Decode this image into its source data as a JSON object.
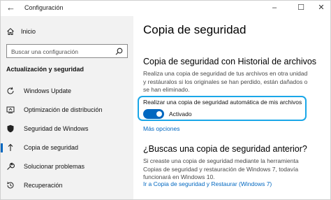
{
  "window": {
    "title": "Configuración"
  },
  "sidebar": {
    "home_label": "Inicio",
    "search_placeholder": "Buscar una configuración",
    "section_title": "Actualización y seguridad",
    "items": [
      {
        "label": "Windows Update",
        "icon": "refresh-icon"
      },
      {
        "label": "Optimización de distribución",
        "icon": "delivery-optimization-icon"
      },
      {
        "label": "Seguridad de Windows",
        "icon": "shield-icon"
      },
      {
        "label": "Copia de seguridad",
        "icon": "backup-arrow-icon",
        "active": true
      },
      {
        "label": "Solucionar problemas",
        "icon": "wrench-icon"
      },
      {
        "label": "Recuperación",
        "icon": "recovery-icon"
      }
    ]
  },
  "main": {
    "title": "Copia de seguridad",
    "history": {
      "heading": "Copia de seguridad con Historial de archivos",
      "description": "Realiza una copia de seguridad de tus archivos en otra unidad y restáuralos si los originales se han perdido, están dañados o se han eliminado.",
      "toggle_label": "Realizar una copia de seguridad automática de mis archivos",
      "toggle_state": "Activado",
      "toggle_on": true,
      "more_options": "Más opciones"
    },
    "older": {
      "heading": "¿Buscas una copia de seguridad anterior?",
      "description": "Si creaste una copia de seguridad mediante la herramienta Copias de seguridad y restauración de Windows 7, todavía funcionará en Windows 10.",
      "link": "Ir a Copia de seguridad y Restaurar (Windows 7)"
    }
  },
  "colors": {
    "accent": "#0067c0",
    "highlight": "#1aa7e8",
    "sidebar_bg": "#f2f2f2"
  }
}
